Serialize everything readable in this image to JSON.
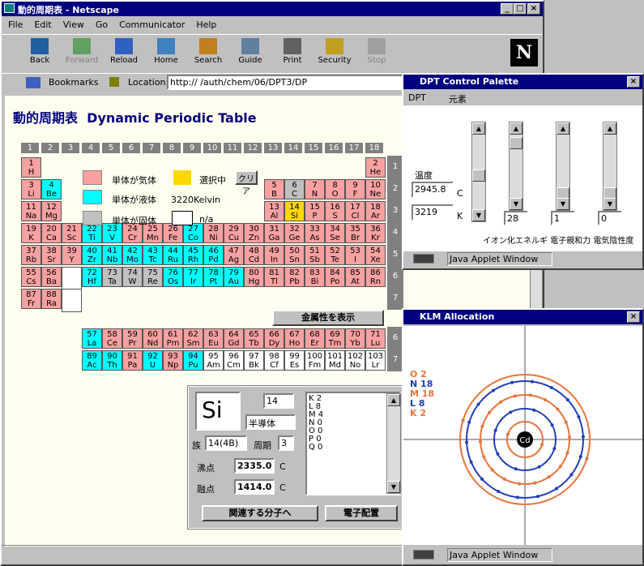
{
  "browser": {
    "title": "動的周期表 - Netscape",
    "menus": [
      "File",
      "Edit",
      "View",
      "Go",
      "Communicator",
      "Help"
    ],
    "toolbar": [
      "Back",
      "Forward",
      "Reload",
      "Home",
      "Search",
      "Guide",
      "Print",
      "Security",
      "Stop"
    ],
    "bookmarks": "Bookmarks",
    "location_label": "Location:",
    "url": "http://                        /auth/chem/06/DPT3/DP"
  },
  "page": {
    "title_jp": "動的周期表",
    "title_en": "Dynamic Periodic Table",
    "groups": [
      "1",
      "2",
      "3",
      "4",
      "5",
      "6",
      "7",
      "8",
      "9",
      "10",
      "11",
      "12",
      "13",
      "14",
      "15",
      "16",
      "17",
      "18"
    ],
    "periods": [
      "1",
      "2",
      "3",
      "4",
      "5",
      "6",
      "7",
      "6",
      "7"
    ],
    "legend": {
      "gas": "単体が気体",
      "liquid": "単体が液体",
      "solid": "単体が固体",
      "selected": "選択中",
      "clear": "クリア",
      "temp": "3220Kelvin",
      "na": "n/a"
    },
    "metal_button": "金属性を表示",
    "elements": [
      {
        "n": "1",
        "s": "H",
        "c": "gas",
        "r": 0,
        "g": 0
      },
      {
        "n": "2",
        "s": "He",
        "c": "gas",
        "r": 0,
        "g": 17
      },
      {
        "n": "3",
        "s": "Li",
        "c": "gas",
        "r": 1,
        "g": 0
      },
      {
        "n": "4",
        "s": "Be",
        "c": "liq",
        "r": 1,
        "g": 1
      },
      {
        "n": "5",
        "s": "B",
        "c": "gas",
        "r": 1,
        "g": 12
      },
      {
        "n": "6",
        "s": "C",
        "c": "sol",
        "r": 1,
        "g": 13
      },
      {
        "n": "7",
        "s": "N",
        "c": "gas",
        "r": 1,
        "g": 14
      },
      {
        "n": "8",
        "s": "O",
        "c": "gas",
        "r": 1,
        "g": 15
      },
      {
        "n": "9",
        "s": "F",
        "c": "gas",
        "r": 1,
        "g": 16
      },
      {
        "n": "10",
        "s": "Ne",
        "c": "gas",
        "r": 1,
        "g": 17
      },
      {
        "n": "11",
        "s": "Na",
        "c": "gas",
        "r": 2,
        "g": 0
      },
      {
        "n": "12",
        "s": "Mg",
        "c": "gas",
        "r": 2,
        "g": 1
      },
      {
        "n": "13",
        "s": "Al",
        "c": "gas",
        "r": 2,
        "g": 12
      },
      {
        "n": "14",
        "s": "Si",
        "c": "sel",
        "r": 2,
        "g": 13
      },
      {
        "n": "15",
        "s": "P",
        "c": "gas",
        "r": 2,
        "g": 14
      },
      {
        "n": "16",
        "s": "S",
        "c": "gas",
        "r": 2,
        "g": 15
      },
      {
        "n": "17",
        "s": "Cl",
        "c": "gas",
        "r": 2,
        "g": 16
      },
      {
        "n": "18",
        "s": "Ar",
        "c": "gas",
        "r": 2,
        "g": 17
      },
      {
        "n": "19",
        "s": "K",
        "c": "gas",
        "r": 3,
        "g": 0
      },
      {
        "n": "20",
        "s": "Ca",
        "c": "gas",
        "r": 3,
        "g": 1
      },
      {
        "n": "21",
        "s": "Sc",
        "c": "gas",
        "r": 3,
        "g": 2
      },
      {
        "n": "22",
        "s": "Ti",
        "c": "liq",
        "r": 3,
        "g": 3
      },
      {
        "n": "23",
        "s": "V",
        "c": "liq",
        "r": 3,
        "g": 4
      },
      {
        "n": "24",
        "s": "Cr",
        "c": "gas",
        "r": 3,
        "g": 5
      },
      {
        "n": "25",
        "s": "Mn",
        "c": "gas",
        "r": 3,
        "g": 6
      },
      {
        "n": "26",
        "s": "Fe",
        "c": "gas",
        "r": 3,
        "g": 7
      },
      {
        "n": "27",
        "s": "Co",
        "c": "liq",
        "r": 3,
        "g": 8
      },
      {
        "n": "28",
        "s": "Ni",
        "c": "gas",
        "r": 3,
        "g": 9
      },
      {
        "n": "29",
        "s": "Cu",
        "c": "gas",
        "r": 3,
        "g": 10
      },
      {
        "n": "30",
        "s": "Zn",
        "c": "gas",
        "r": 3,
        "g": 11
      },
      {
        "n": "31",
        "s": "Ga",
        "c": "gas",
        "r": 3,
        "g": 12
      },
      {
        "n": "32",
        "s": "Ge",
        "c": "gas",
        "r": 3,
        "g": 13
      },
      {
        "n": "33",
        "s": "As",
        "c": "gas",
        "r": 3,
        "g": 14
      },
      {
        "n": "34",
        "s": "Se",
        "c": "gas",
        "r": 3,
        "g": 15
      },
      {
        "n": "35",
        "s": "Br",
        "c": "gas",
        "r": 3,
        "g": 16
      },
      {
        "n": "36",
        "s": "Kr",
        "c": "gas",
        "r": 3,
        "g": 17
      },
      {
        "n": "37",
        "s": "Rb",
        "c": "gas",
        "r": 4,
        "g": 0
      },
      {
        "n": "38",
        "s": "Sr",
        "c": "gas",
        "r": 4,
        "g": 1
      },
      {
        "n": "39",
        "s": "Y",
        "c": "gas",
        "r": 4,
        "g": 2
      },
      {
        "n": "40",
        "s": "Zr",
        "c": "liq",
        "r": 4,
        "g": 3
      },
      {
        "n": "41",
        "s": "Nb",
        "c": "liq",
        "r": 4,
        "g": 4
      },
      {
        "n": "42",
        "s": "Mo",
        "c": "liq",
        "r": 4,
        "g": 5
      },
      {
        "n": "43",
        "s": "Tc",
        "c": "liq",
        "r": 4,
        "g": 6
      },
      {
        "n": "44",
        "s": "Ru",
        "c": "liq",
        "r": 4,
        "g": 7
      },
      {
        "n": "45",
        "s": "Rh",
        "c": "liq",
        "r": 4,
        "g": 8
      },
      {
        "n": "46",
        "s": "Pd",
        "c": "liq",
        "r": 4,
        "g": 9
      },
      {
        "n": "47",
        "s": "Ag",
        "c": "gas",
        "r": 4,
        "g": 10
      },
      {
        "n": "48",
        "s": "Cd",
        "c": "gas",
        "r": 4,
        "g": 11
      },
      {
        "n": "49",
        "s": "In",
        "c": "gas",
        "r": 4,
        "g": 12
      },
      {
        "n": "50",
        "s": "Sn",
        "c": "gas",
        "r": 4,
        "g": 13
      },
      {
        "n": "51",
        "s": "Sb",
        "c": "gas",
        "r": 4,
        "g": 14
      },
      {
        "n": "52",
        "s": "Te",
        "c": "gas",
        "r": 4,
        "g": 15
      },
      {
        "n": "53",
        "s": "I",
        "c": "gas",
        "r": 4,
        "g": 16
      },
      {
        "n": "54",
        "s": "Xe",
        "c": "gas",
        "r": 4,
        "g": 17
      },
      {
        "n": "55",
        "s": "Cs",
        "c": "gas",
        "r": 5,
        "g": 0
      },
      {
        "n": "56",
        "s": "Ba",
        "c": "gas",
        "r": 5,
        "g": 1
      },
      {
        "n": "",
        "s": "",
        "c": "wht",
        "r": 5,
        "g": 2
      },
      {
        "n": "72",
        "s": "Hf",
        "c": "liq",
        "r": 5,
        "g": 3
      },
      {
        "n": "73",
        "s": "Ta",
        "c": "sol",
        "r": 5,
        "g": 4
      },
      {
        "n": "74",
        "s": "W",
        "c": "sol",
        "r": 5,
        "g": 5
      },
      {
        "n": "75",
        "s": "Re",
        "c": "sol",
        "r": 5,
        "g": 6
      },
      {
        "n": "76",
        "s": "Os",
        "c": "liq",
        "r": 5,
        "g": 7
      },
      {
        "n": "77",
        "s": "Ir",
        "c": "liq",
        "r": 5,
        "g": 8
      },
      {
        "n": "78",
        "s": "Pt",
        "c": "liq",
        "r": 5,
        "g": 9
      },
      {
        "n": "79",
        "s": "Au",
        "c": "liq",
        "r": 5,
        "g": 10
      },
      {
        "n": "80",
        "s": "Hg",
        "c": "gas",
        "r": 5,
        "g": 11
      },
      {
        "n": "81",
        "s": "Tl",
        "c": "gas",
        "r": 5,
        "g": 12
      },
      {
        "n": "82",
        "s": "Pb",
        "c": "gas",
        "r": 5,
        "g": 13
      },
      {
        "n": "83",
        "s": "Bi",
        "c": "gas",
        "r": 5,
        "g": 14
      },
      {
        "n": "84",
        "s": "Po",
        "c": "gas",
        "r": 5,
        "g": 15
      },
      {
        "n": "85",
        "s": "At",
        "c": "gas",
        "r": 5,
        "g": 16
      },
      {
        "n": "86",
        "s": "Rn",
        "c": "gas",
        "r": 5,
        "g": 17
      },
      {
        "n": "87",
        "s": "Fr",
        "c": "gas",
        "r": 6,
        "g": 0
      },
      {
        "n": "88",
        "s": "Ra",
        "c": "gas",
        "r": 6,
        "g": 1
      },
      {
        "n": "",
        "s": "",
        "c": "wht",
        "r": 6,
        "g": 2
      },
      {
        "n": "57",
        "s": "La",
        "c": "liq",
        "r": 7,
        "g": 3
      },
      {
        "n": "58",
        "s": "Ce",
        "c": "gas",
        "r": 7,
        "g": 4
      },
      {
        "n": "59",
        "s": "Pr",
        "c": "gas",
        "r": 7,
        "g": 5
      },
      {
        "n": "60",
        "s": "Nd",
        "c": "gas",
        "r": 7,
        "g": 6
      },
      {
        "n": "61",
        "s": "Pm",
        "c": "gas",
        "r": 7,
        "g": 7
      },
      {
        "n": "62",
        "s": "Sm",
        "c": "gas",
        "r": 7,
        "g": 8
      },
      {
        "n": "63",
        "s": "Eu",
        "c": "gas",
        "r": 7,
        "g": 9
      },
      {
        "n": "64",
        "s": "Gd",
        "c": "gas",
        "r": 7,
        "g": 10
      },
      {
        "n": "65",
        "s": "Tb",
        "c": "gas",
        "r": 7,
        "g": 11
      },
      {
        "n": "66",
        "s": "Dy",
        "c": "gas",
        "r": 7,
        "g": 12
      },
      {
        "n": "67",
        "s": "Ho",
        "c": "gas",
        "r": 7,
        "g": 13
      },
      {
        "n": "68",
        "s": "Er",
        "c": "gas",
        "r": 7,
        "g": 14
      },
      {
        "n": "69",
        "s": "Tm",
        "c": "gas",
        "r": 7,
        "g": 15
      },
      {
        "n": "70",
        "s": "Yb",
        "c": "gas",
        "r": 7,
        "g": 16
      },
      {
        "n": "71",
        "s": "Lu",
        "c": "gas",
        "r": 7,
        "g": 17
      },
      {
        "n": "89",
        "s": "Ac",
        "c": "liq",
        "r": 8,
        "g": 3
      },
      {
        "n": "90",
        "s": "Th",
        "c": "liq",
        "r": 8,
        "g": 4
      },
      {
        "n": "91",
        "s": "Pa",
        "c": "gas",
        "r": 8,
        "g": 5
      },
      {
        "n": "92",
        "s": "U",
        "c": "liq",
        "r": 8,
        "g": 6
      },
      {
        "n": "93",
        "s": "Np",
        "c": "gas",
        "r": 8,
        "g": 7
      },
      {
        "n": "94",
        "s": "Pu",
        "c": "liq",
        "r": 8,
        "g": 8
      },
      {
        "n": "95",
        "s": "Am",
        "c": "wht",
        "r": 8,
        "g": 9
      },
      {
        "n": "96",
        "s": "Cm",
        "c": "wht",
        "r": 8,
        "g": 10
      },
      {
        "n": "97",
        "s": "Bk",
        "c": "wht",
        "r": 8,
        "g": 11
      },
      {
        "n": "98",
        "s": "Cf",
        "c": "wht",
        "r": 8,
        "g": 12
      },
      {
        "n": "99",
        "s": "Es",
        "c": "wht",
        "r": 8,
        "g": 13
      },
      {
        "n": "100",
        "s": "Fm",
        "c": "wht",
        "r": 8,
        "g": 14
      },
      {
        "n": "101",
        "s": "Md",
        "c": "wht",
        "r": 8,
        "g": 15
      },
      {
        "n": "102",
        "s": "No",
        "c": "wht",
        "r": 8,
        "g": 16
      },
      {
        "n": "103",
        "s": "Lr",
        "c": "wht",
        "r": 8,
        "g": 17
      }
    ],
    "detail": {
      "symbol": "Si",
      "number": "14",
      "type": "半導体",
      "group_label": "族",
      "group": "14(4B)",
      "period_label": "周期",
      "period": "3",
      "bp_label": "沸点",
      "bp": "2335.0",
      "mp_label": "融点",
      "mp": "1414.0",
      "unit": "C",
      "shells": [
        "K 2",
        "L 8",
        "M 4",
        "N 0",
        "O 0",
        "P 0",
        "Q 0"
      ],
      "btn_mol": "関連する分子へ",
      "btn_elec": "電子配置"
    }
  },
  "palette": {
    "title": "DPT Control Palette",
    "menus": [
      "DPT",
      "元素"
    ],
    "temp_label": "温度",
    "temp_c": "2945.8",
    "c_unit": "C",
    "temp_k": "3219",
    "k_unit": "K",
    "values": [
      "28",
      "1",
      "0"
    ],
    "bottom_label": "イオン化エネルギ 電子親和力 電気陰性度",
    "status": "Java Applet Window"
  },
  "klm": {
    "title": "KLM Allocation",
    "center": "Cd",
    "labels": [
      {
        "t": "O 2",
        "c": "#e8743b"
      },
      {
        "t": "N 18",
        "c": "#1f3fb8"
      },
      {
        "t": "M 18",
        "c": "#e8743b"
      },
      {
        "t": "L 8",
        "c": "#1f3fb8"
      },
      {
        "t": "K 2",
        "c": "#e8743b"
      }
    ],
    "status": "Java Applet Window"
  }
}
